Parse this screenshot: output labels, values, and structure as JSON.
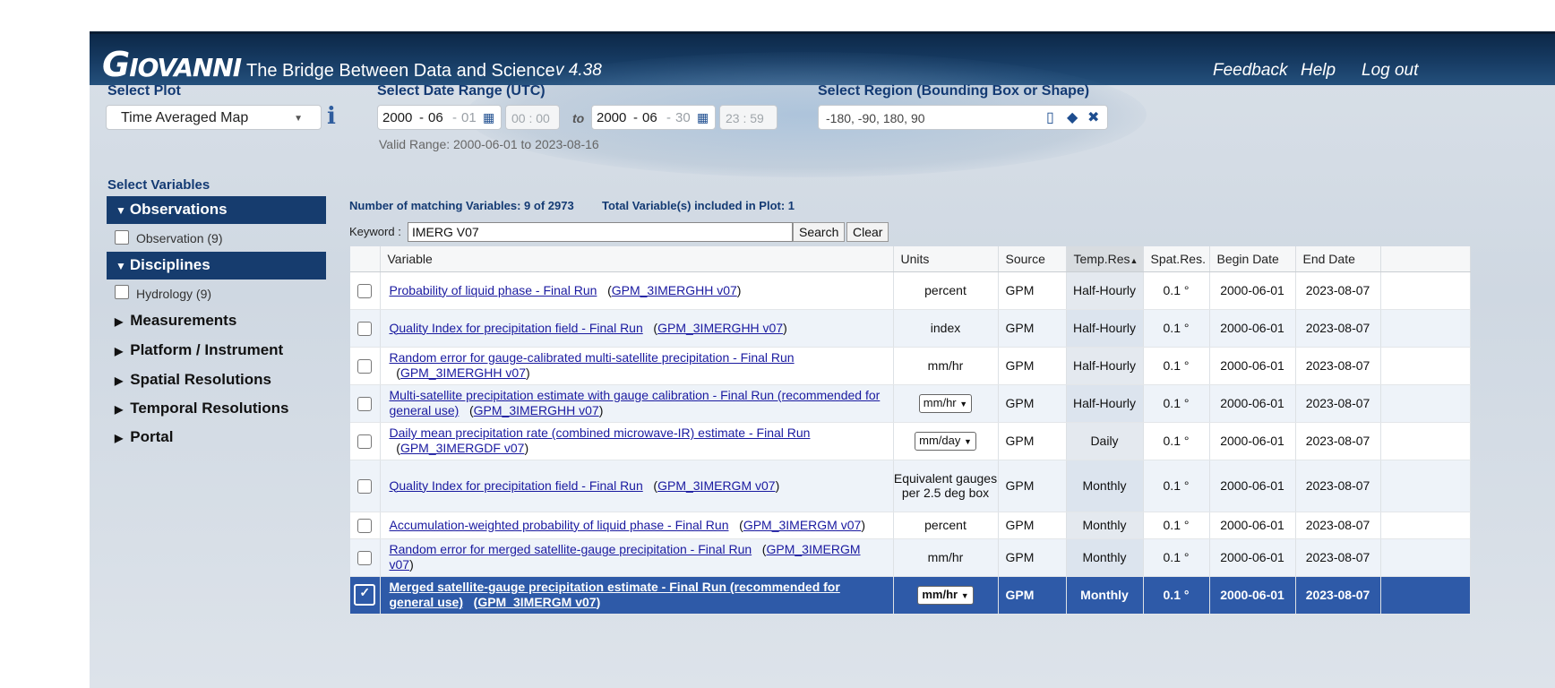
{
  "header": {
    "logo": "GIOVANNI",
    "tagline": "The Bridge Between Data and Science",
    "version": "v 4.38",
    "links": [
      "Feedback",
      "Help",
      "Log out"
    ]
  },
  "plot": {
    "label": "Select Plot",
    "value": "Time Averaged Map"
  },
  "date_range": {
    "label": "Select Date Range (UTC)",
    "start": {
      "year": "2000",
      "month": "06",
      "day": "01",
      "time": "00 : 00"
    },
    "to": "to",
    "end": {
      "year": "2000",
      "month": "06",
      "day": "30",
      "time": "23 : 59"
    },
    "valid": "Valid Range: 2000-06-01 to 2023-08-16"
  },
  "region": {
    "label": "Select Region (Bounding Box or Shape)",
    "value": "-180, -90, 180, 90"
  },
  "sidebar": {
    "label": "Select Variables",
    "observations": {
      "title": "Observations",
      "option": "Observation (9)"
    },
    "disciplines": {
      "title": "Disciplines",
      "option": "Hydrology (9)"
    },
    "items": [
      "Measurements",
      "Platform / Instrument",
      "Spatial Resolutions",
      "Temporal Resolutions",
      "Portal"
    ]
  },
  "search": {
    "matching": "Number of matching Variables: 9 of 2973",
    "included": "Total Variable(s) included in Plot: 1",
    "keyword_label": "Keyword :",
    "keyword": "IMERG V07",
    "search_btn": "Search",
    "clear_btn": "Clear"
  },
  "table": {
    "headers": [
      "Variable",
      "Units",
      "Source",
      "Temp.Res",
      "Spat.Res.",
      "Begin Date",
      "End Date"
    ],
    "rows": [
      {
        "name": "Probability of liquid phase - Final Run",
        "product": "GPM_3IMERGHH v07",
        "units": "percent",
        "unit_select": false,
        "source": "GPM",
        "temp": "Half-Hourly",
        "spat": "0.1 °",
        "begin": "2000-06-01",
        "end": "2023-08-07"
      },
      {
        "name": "Quality Index for precipitation field - Final Run",
        "product": "GPM_3IMERGHH v07",
        "units": "index",
        "unit_select": false,
        "source": "GPM",
        "temp": "Half-Hourly",
        "spat": "0.1 °",
        "begin": "2000-06-01",
        "end": "2023-08-07"
      },
      {
        "name": "Random error for gauge-calibrated multi-satellite precipitation - Final Run",
        "product": "GPM_3IMERGHH v07",
        "units": "mm/hr",
        "unit_select": false,
        "source": "GPM",
        "temp": "Half-Hourly",
        "spat": "0.1 °",
        "begin": "2000-06-01",
        "end": "2023-08-07"
      },
      {
        "name": "Multi-satellite precipitation estimate with gauge calibration - Final Run (recommended for general use)",
        "product": "GPM_3IMERGHH v07",
        "units": "mm/hr",
        "unit_select": true,
        "source": "GPM",
        "temp": "Half-Hourly",
        "spat": "0.1 °",
        "begin": "2000-06-01",
        "end": "2023-08-07"
      },
      {
        "name": "Daily mean precipitation rate (combined microwave-IR) estimate - Final Run",
        "product": "GPM_3IMERGDF v07",
        "units": "mm/day",
        "unit_select": true,
        "source": "GPM",
        "temp": "Daily",
        "spat": "0.1 °",
        "begin": "2000-06-01",
        "end": "2023-08-07"
      },
      {
        "name": "Quality Index for precipitation field - Final Run",
        "product": "GPM_3IMERGM v07",
        "units": "Equivalent gauges per 2.5 deg box",
        "unit_select": false,
        "source": "GPM",
        "temp": "Monthly",
        "spat": "0.1 °",
        "begin": "2000-06-01",
        "end": "2023-08-07"
      },
      {
        "name": "Accumulation-weighted probability of liquid phase - Final Run",
        "product": "GPM_3IMERGM v07",
        "units": "percent",
        "unit_select": false,
        "source": "GPM",
        "temp": "Monthly",
        "spat": "0.1 °",
        "begin": "2000-06-01",
        "end": "2023-08-07"
      },
      {
        "name": "Random error for merged satellite-gauge precipitation - Final Run",
        "product": "GPM_3IMERGM v07",
        "units": "mm/hr",
        "unit_select": false,
        "source": "GPM",
        "temp": "Monthly",
        "spat": "0.1 °",
        "begin": "2000-06-01",
        "end": "2023-08-07"
      },
      {
        "name": "Merged satellite-gauge precipitation estimate - Final Run (recommended for general use)",
        "product": "GPM_3IMERGM v07",
        "units": "mm/hr",
        "unit_select": true,
        "source": "GPM",
        "temp": "Monthly",
        "spat": "0.1 °",
        "begin": "2000-06-01",
        "end": "2023-08-07",
        "selected": true
      }
    ]
  },
  "colors": {
    "header_bg": "#163c6e",
    "link": "#1a1aa0",
    "selected_row": "#2e5aa8",
    "label": "#133a73"
  }
}
